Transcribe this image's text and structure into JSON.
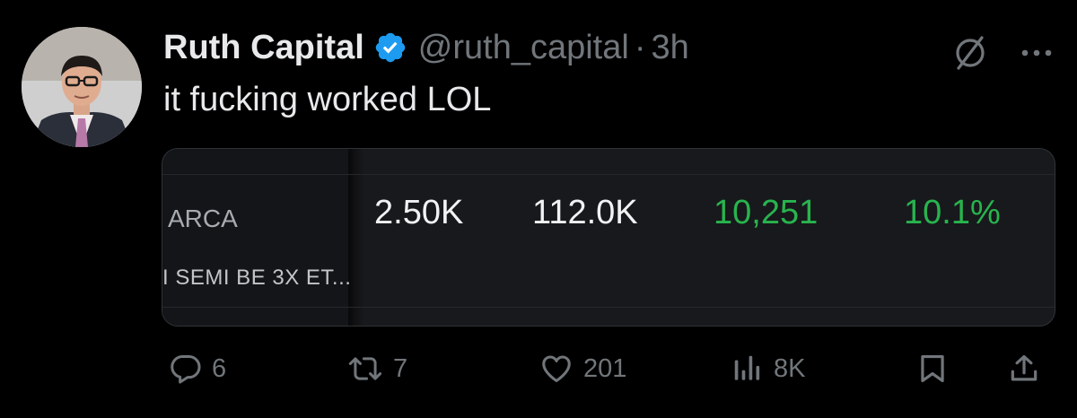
{
  "tweet": {
    "display_name": "Ruth Capital",
    "handle": "@ruth_capital",
    "separator": "·",
    "time": "3h",
    "text": "it fucking worked LOL"
  },
  "card": {
    "exchange": "ARCA",
    "fund_name": "I SEMI BE 3X ET...",
    "stats": [
      "2.50K",
      "112.0K",
      "10,251",
      "10.1%"
    ]
  },
  "actions": {
    "replies": "6",
    "reposts": "7",
    "likes": "201",
    "views": "8K"
  },
  "colors": {
    "background": "#000000",
    "text": "#e7e9ea",
    "muted": "#71767b",
    "verified": "#1d9bf0",
    "positive": "#28b44e"
  }
}
